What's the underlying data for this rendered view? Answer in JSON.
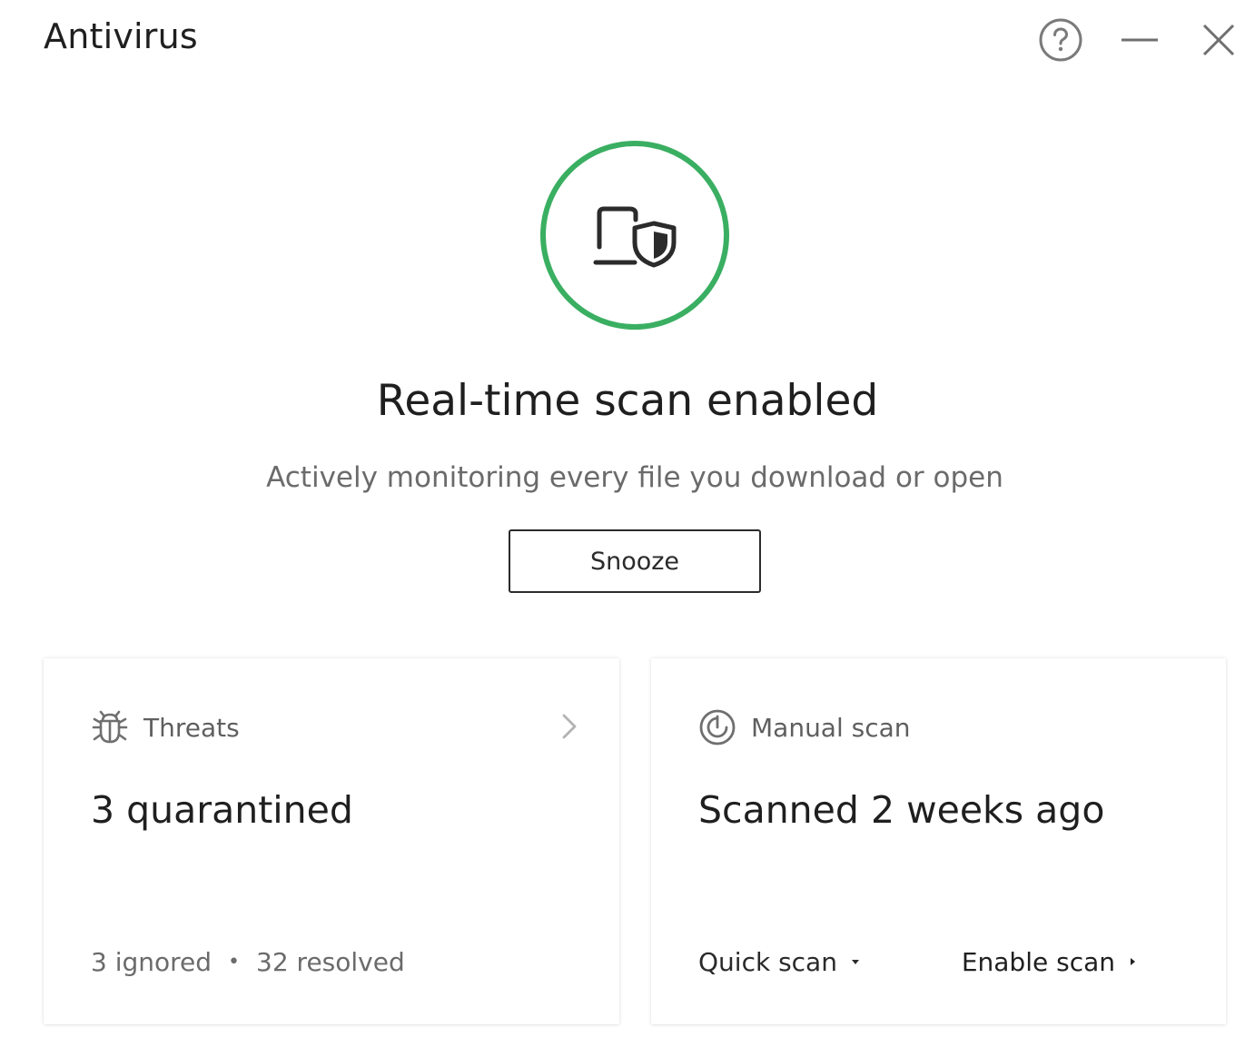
{
  "app": {
    "title": "Antivirus"
  },
  "window_controls": {
    "help_icon": "help-circle-icon",
    "minimize_icon": "minimize-icon",
    "close_icon": "close-icon"
  },
  "status": {
    "icon": "laptop-shield-icon",
    "ring_color": "#3aaf62",
    "headline": "Real-time scan enabled",
    "subtitle": "Actively monitoring every file you download or open",
    "snooze_label": "Snooze"
  },
  "threats_card": {
    "icon": "bug-icon",
    "label": "Threats",
    "value": "3 quarantined",
    "ignored": "3 ignored",
    "separator": "•",
    "resolved": "32 resolved"
  },
  "scan_card": {
    "icon": "scan-gauge-icon",
    "label": "Manual scan",
    "value": "Scanned 2 weeks ago",
    "quick_scan_label": "Quick scan",
    "enable_scan_label": "Enable scan"
  }
}
